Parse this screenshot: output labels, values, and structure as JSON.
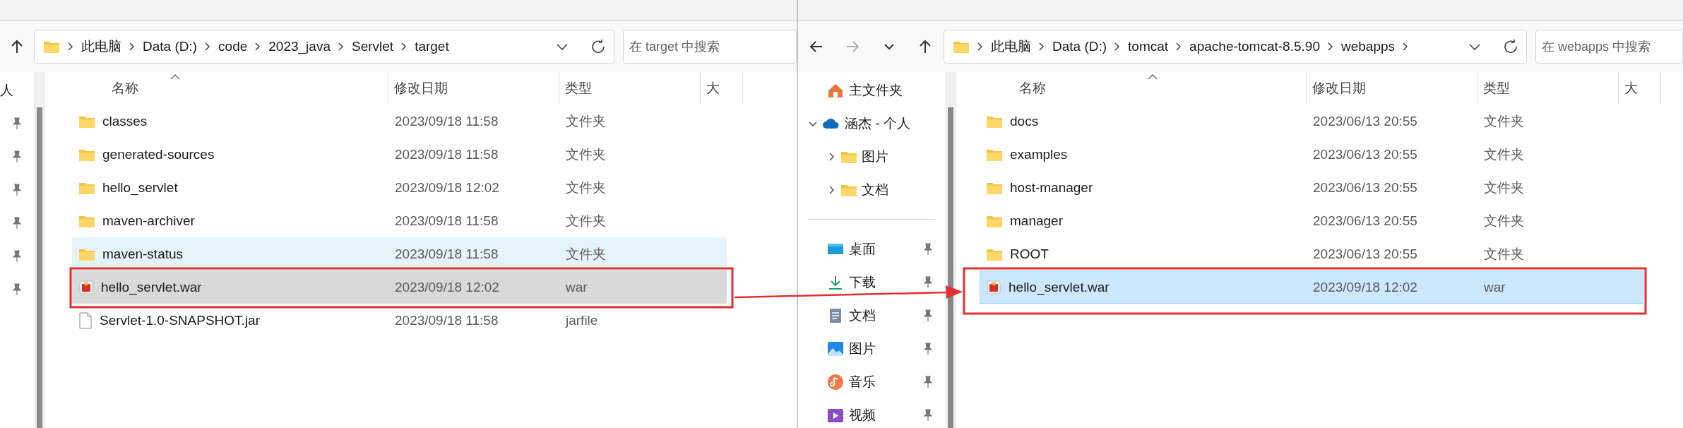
{
  "windows": [
    {
      "active": false,
      "nav": [
        {
          "kind": "up",
          "disabled": false
        }
      ],
      "address_path": [
        "此电脑",
        "Data (D:)",
        "code",
        "2023_java",
        "Servlet",
        "target"
      ],
      "trailing_chevron": false,
      "search": {
        "placeholder": "在 target 中搜索"
      },
      "sidebar": {
        "items": [
          {
            "kind": "plain",
            "label": "人"
          },
          {
            "kind": "hidden",
            "pinned": true
          },
          {
            "kind": "hidden",
            "pinned": true
          },
          {
            "kind": "hidden",
            "pinned": true
          },
          {
            "kind": "hidden",
            "pinned": true
          },
          {
            "kind": "hidden",
            "pinned": true
          },
          {
            "kind": "hidden",
            "pinned": true
          }
        ]
      },
      "columns": [
        "名称",
        "修改日期",
        "类型",
        "大"
      ],
      "rows": [
        {
          "name": "classes",
          "modified": "2023/09/18 11:58",
          "type": "文件夹",
          "kind": "folder",
          "selected": false,
          "hovered": false
        },
        {
          "name": "generated-sources",
          "modified": "2023/09/18 11:58",
          "type": "文件夹",
          "kind": "folder",
          "selected": false,
          "hovered": false
        },
        {
          "name": "hello_servlet",
          "modified": "2023/09/18 12:02",
          "type": "文件夹",
          "kind": "folder",
          "selected": false,
          "hovered": false
        },
        {
          "name": "maven-archiver",
          "modified": "2023/09/18 11:58",
          "type": "文件夹",
          "kind": "folder",
          "selected": false,
          "hovered": false
        },
        {
          "name": "maven-status",
          "modified": "2023/09/18 11:58",
          "type": "文件夹",
          "kind": "folder",
          "selected": false,
          "hovered": true
        },
        {
          "name": "hello_servlet.war",
          "modified": "2023/09/18 12:02",
          "type": "war",
          "kind": "war",
          "selected": true
        },
        {
          "name": "Servlet-1.0-SNAPSHOT.jar",
          "modified": "2023/09/18 11:58",
          "type": "jarfile",
          "kind": "file",
          "selected": false,
          "hovered": false
        }
      ]
    },
    {
      "active": true,
      "nav": [
        {
          "kind": "back",
          "disabled": false
        },
        {
          "kind": "forward",
          "disabled": true
        },
        {
          "kind": "recent",
          "disabled": false
        },
        {
          "kind": "up",
          "disabled": false
        }
      ],
      "address_path": [
        "此电脑",
        "Data (D:)",
        "tomcat",
        "apache-tomcat-8.5.90",
        "webapps"
      ],
      "trailing_chevron": true,
      "search": {
        "placeholder": "在 webapps 中搜索"
      },
      "sidebar": {
        "items": [
          {
            "kind": "home",
            "label": "主文件夹"
          },
          {
            "kind": "cloud",
            "label": "涵杰 - 个人",
            "expanded": true,
            "children": [
              {
                "kind": "folder",
                "label": "图片",
                "expanded": false
              },
              {
                "kind": "folder",
                "label": "文档",
                "expanded": false
              }
            ]
          },
          {
            "kind": "divider"
          },
          {
            "kind": "desktop",
            "label": "桌面",
            "pinned": true
          },
          {
            "kind": "download",
            "label": "下载",
            "pinned": true
          },
          {
            "kind": "document",
            "label": "文档",
            "pinned": true
          },
          {
            "kind": "picture",
            "label": "图片",
            "pinned": true
          },
          {
            "kind": "music",
            "label": "音乐",
            "pinned": true
          },
          {
            "kind": "video",
            "label": "视频",
            "pinned": true
          }
        ]
      },
      "columns": [
        "名称",
        "修改日期",
        "类型",
        "大"
      ],
      "rows": [
        {
          "name": "docs",
          "modified": "2023/06/13 20:55",
          "type": "文件夹",
          "kind": "folder",
          "selected": false,
          "hovered": false
        },
        {
          "name": "examples",
          "modified": "2023/06/13 20:55",
          "type": "文件夹",
          "kind": "folder",
          "selected": false,
          "hovered": false
        },
        {
          "name": "host-manager",
          "modified": "2023/06/13 20:55",
          "type": "文件夹",
          "kind": "folder",
          "selected": false,
          "hovered": false
        },
        {
          "name": "manager",
          "modified": "2023/06/13 20:55",
          "type": "文件夹",
          "kind": "folder",
          "selected": false,
          "hovered": false
        },
        {
          "name": "ROOT",
          "modified": "2023/06/13 20:55",
          "type": "文件夹",
          "kind": "folder",
          "selected": false,
          "hovered": false
        },
        {
          "name": "hello_servlet.war",
          "modified": "2023/09/18 12:02",
          "type": "war",
          "kind": "war",
          "selected": true
        }
      ]
    }
  ],
  "annotations": [
    {
      "kind": "box"
    },
    {
      "kind": "arrow"
    },
    {
      "kind": "box"
    }
  ]
}
